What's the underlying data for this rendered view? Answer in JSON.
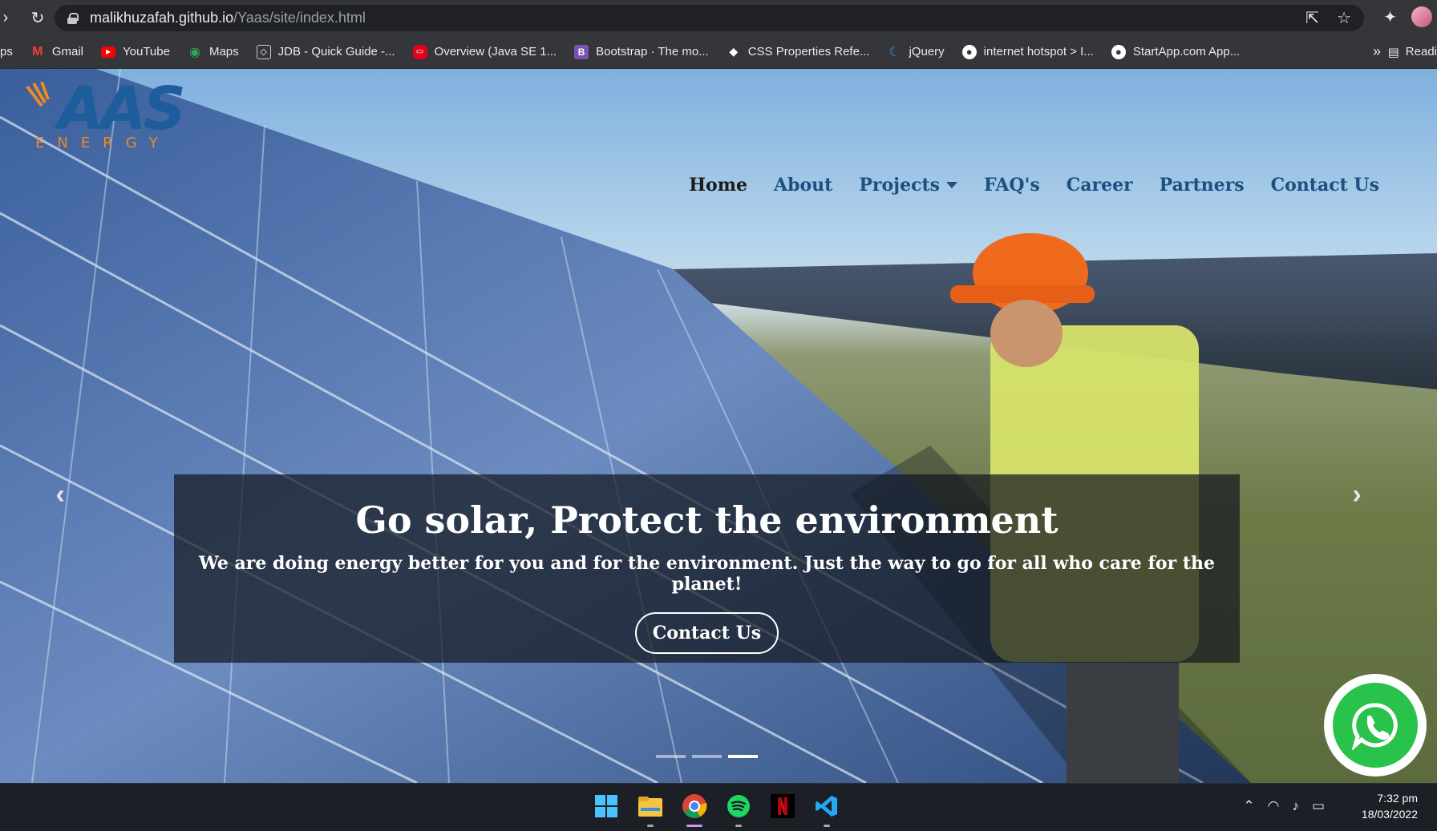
{
  "browser": {
    "url_host": "malikhuzafah.github.io",
    "url_path": "/Yaas/site/index.html",
    "bookmarks": [
      {
        "label": "ps",
        "icon": "apps-icon",
        "color": ""
      },
      {
        "label": "Gmail",
        "icon": "gmail-icon",
        "color": "#ea4335"
      },
      {
        "label": "YouTube",
        "icon": "youtube-icon",
        "color": "#ff0000"
      },
      {
        "label": "Maps",
        "icon": "maps-icon",
        "color": "#34a853"
      },
      {
        "label": "JDB - Quick Guide -...",
        "icon": "jdb-icon",
        "color": "#ffffff"
      },
      {
        "label": "Overview (Java SE 1...",
        "icon": "oracle-icon",
        "color": "#e3001b"
      },
      {
        "label": "Bootstrap · The mo...",
        "icon": "bootstrap-icon",
        "color": "#7952b3"
      },
      {
        "label": "CSS Properties Refe...",
        "icon": "css-icon",
        "color": "#ffffff"
      },
      {
        "label": "jQuery",
        "icon": "jquery-icon",
        "color": "#0769ad"
      },
      {
        "label": "internet hotspot > I...",
        "icon": "globe-icon",
        "color": "#ffffff"
      },
      {
        "label": "StartApp.com App...",
        "icon": "globe-icon",
        "color": "#ffffff"
      }
    ],
    "more": "»",
    "reading_list": "Readi"
  },
  "site": {
    "logo_main": "AAS",
    "logo_sub": "ENERGY",
    "nav": [
      {
        "label": "Home",
        "active": true
      },
      {
        "label": "About"
      },
      {
        "label": "Projects",
        "dropdown": true
      },
      {
        "label": "FAQ's"
      },
      {
        "label": "Career"
      },
      {
        "label": "Partners"
      },
      {
        "label": "Contact Us"
      }
    ],
    "hero": {
      "title": "Go solar, Protect the environment",
      "subtitle": "We are doing energy better for you and for the environment. Just the way to go for all who care for the planet!",
      "button": "Contact Us",
      "slides": 3,
      "active_slide": 3
    }
  },
  "taskbar": {
    "apps": [
      "windows-start-icon",
      "file-explorer-icon",
      "chrome-icon",
      "spotify-icon",
      "netflix-icon",
      "vscode-icon"
    ],
    "time": "7:32 pm",
    "date": "18/03/2022"
  }
}
